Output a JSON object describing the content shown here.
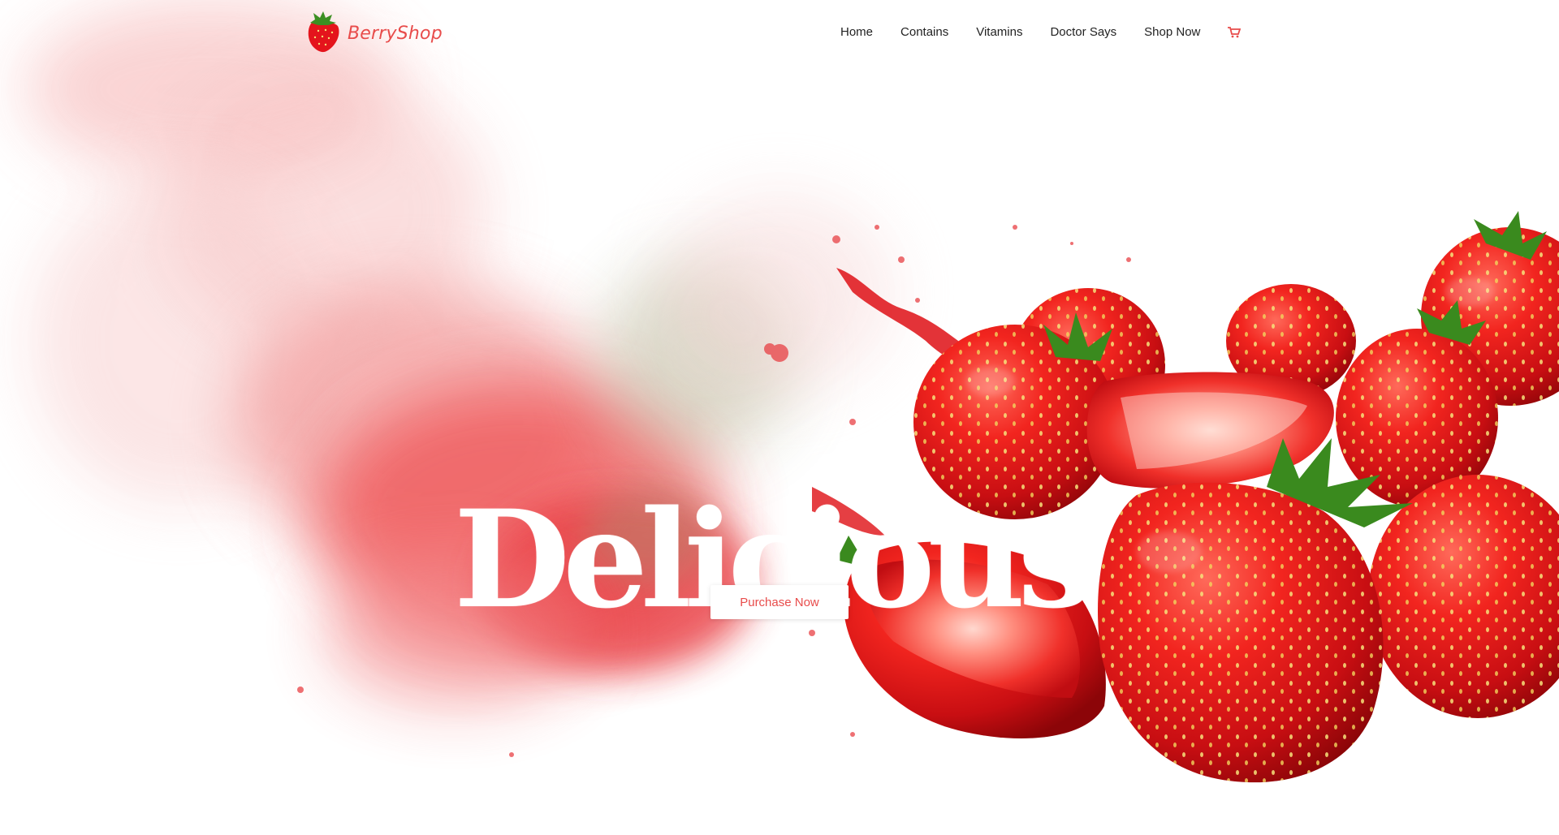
{
  "brand": {
    "name": "BerryShop"
  },
  "nav": {
    "items": [
      {
        "label": "Home"
      },
      {
        "label": "Contains"
      },
      {
        "label": "Vitamins"
      },
      {
        "label": "Doctor Says"
      },
      {
        "label": "Shop Now"
      }
    ],
    "cart_icon": "shopping-cart-icon"
  },
  "hero": {
    "headline": "Delicious",
    "cta_label": "Purchase Now",
    "image": "strawberry-splash-illustration"
  },
  "colors": {
    "accent": "#e84c4b",
    "nav_text": "#222222",
    "background": "#ffffff",
    "strawberry_red": "#d9141b",
    "leaf_green": "#3a8a1e"
  }
}
